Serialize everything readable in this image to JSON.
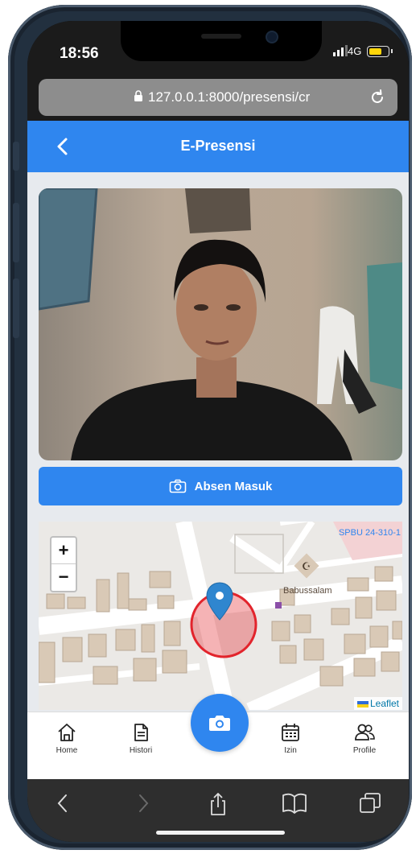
{
  "status_bar": {
    "time": "18:56",
    "network": "4G"
  },
  "browser": {
    "url": "127.0.0.1:8000/presensi/cr"
  },
  "header": {
    "title": "E-Presensi"
  },
  "attendance": {
    "button_label": "Absen Masuk"
  },
  "map": {
    "zoom_in": "+",
    "zoom_out": "−",
    "labels": {
      "poi": "Babussalam",
      "station": "SPBU 24-310-1"
    },
    "attribution": "Leaflet"
  },
  "bottom_nav": {
    "items": [
      {
        "label": "Home",
        "icon": "home-icon"
      },
      {
        "label": "Histori",
        "icon": "document-icon"
      },
      {
        "label": "",
        "icon": "camera-icon"
      },
      {
        "label": "Izin",
        "icon": "calendar-icon"
      },
      {
        "label": "Profile",
        "icon": "users-icon"
      }
    ]
  },
  "colors": {
    "primary": "#2f86ef",
    "accuracy_circle": "#e2242c",
    "marker": "#2f86cf"
  }
}
